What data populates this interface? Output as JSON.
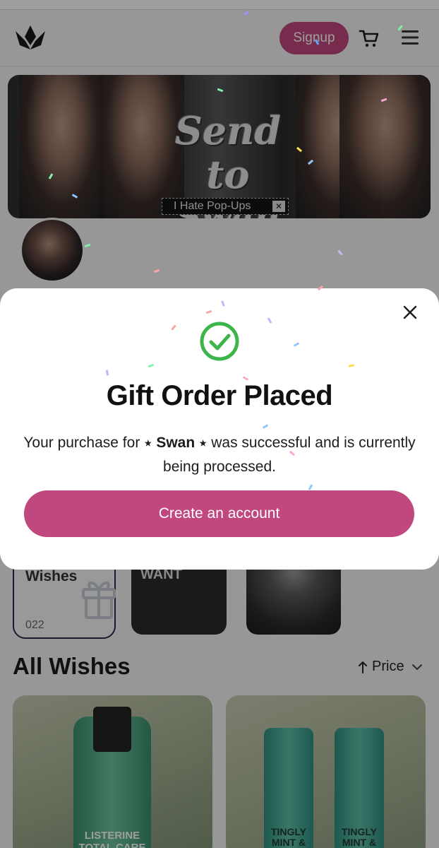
{
  "header": {
    "signup_label": "Signup"
  },
  "banner": {
    "title_line1": "Send to",
    "title_line2": "Swan",
    "popup_text": "I Hate Pop-Ups",
    "popup_close": "✕"
  },
  "categories": [
    {
      "label": "Wishes",
      "count": "022"
    },
    {
      "label": "WANT"
    }
  ],
  "section": {
    "title": "All Wishes",
    "sort_label": "Price"
  },
  "products": [
    {
      "label": "LISTERINE TOTAL CARE TEETH & GUM"
    },
    {
      "label": "TINGLY MINT & TEA TREE ORIGINAL SOURCE"
    }
  ],
  "modal": {
    "title": "Gift Order Placed",
    "body_prefix": "Your purchase for ",
    "star": "⭑",
    "recipient": "Swan",
    "body_suffix": " was successful and is currently being processed.",
    "cta_label": "Create an account"
  },
  "colors": {
    "accent": "#c0487f",
    "success": "#3cb54a"
  },
  "icons": [
    "crown-logo-icon",
    "cart-icon",
    "menu-icon",
    "close-icon",
    "check-circle-icon",
    "gift-icon",
    "arrow-up-icon",
    "chevron-down-icon"
  ]
}
